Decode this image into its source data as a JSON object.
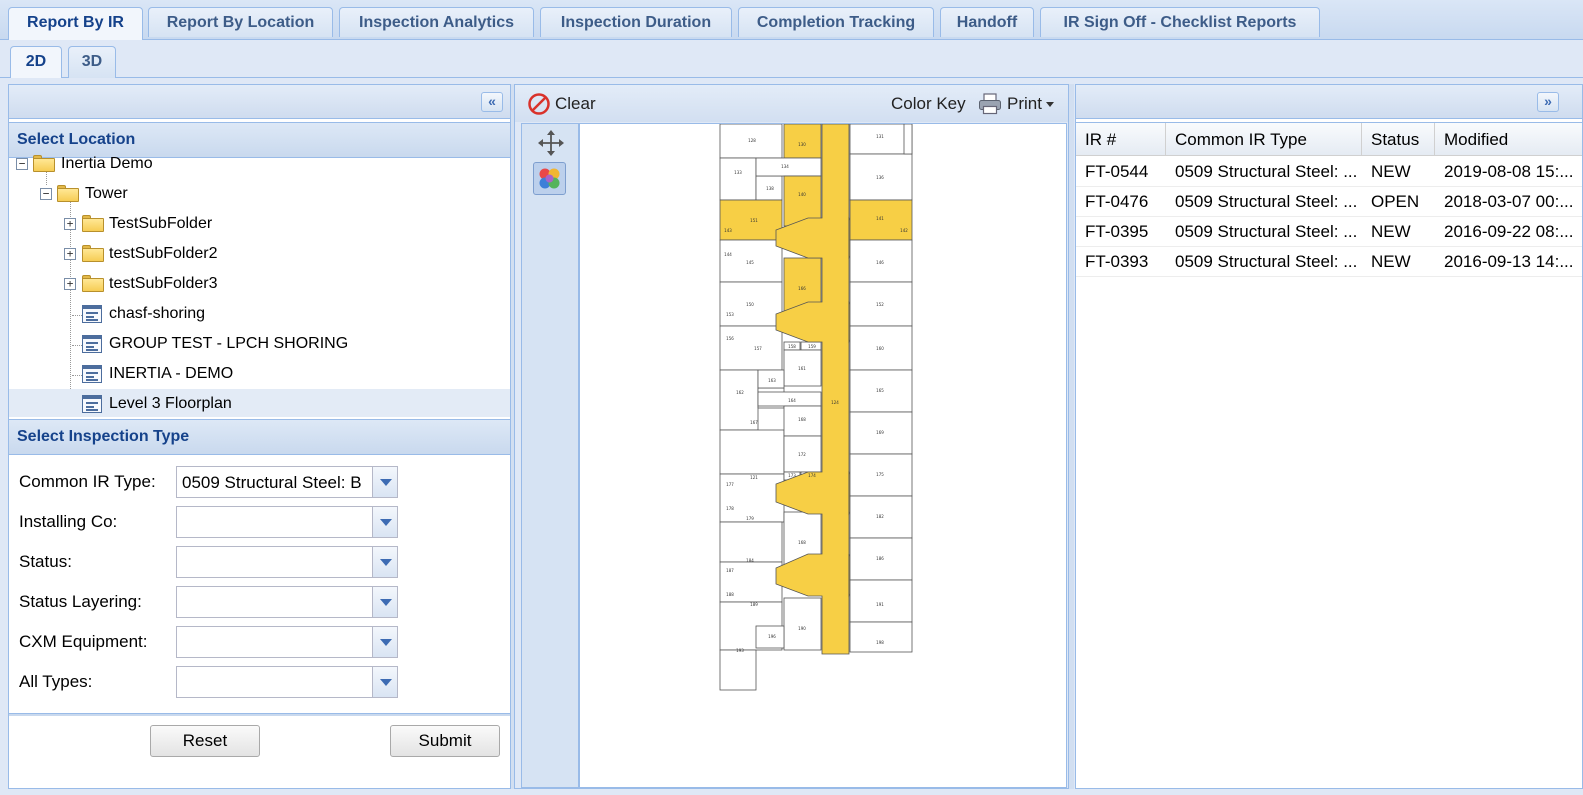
{
  "top_tabs": [
    "Report By IR",
    "Report By Location",
    "Inspection Analytics",
    "Inspection Duration",
    "Completion Tracking",
    "Handoff",
    "IR Sign Off - Checklist Reports"
  ],
  "view_tabs": [
    "2D",
    "3D"
  ],
  "left": {
    "location_title": "Select Location",
    "tree": {
      "root": "Inertia Demo",
      "tower": "Tower",
      "folders": [
        "TestSubFolder",
        "testSubFolder2",
        "testSubFolder3"
      ],
      "leaves": [
        "chasf-shoring",
        "GROUP TEST - LPCH SHORING",
        "INERTIA - DEMO",
        "Level 3 Floorplan"
      ]
    },
    "inspection_title": "Select Inspection Type",
    "fields": [
      {
        "label": "Common IR Type:",
        "value": "0509 Structural Steel: B"
      },
      {
        "label": "Installing Co:",
        "value": ""
      },
      {
        "label": "Status:",
        "value": ""
      },
      {
        "label": "Status Layering:",
        "value": ""
      },
      {
        "label": "CXM Equipment:",
        "value": ""
      },
      {
        "label": "All Types:",
        "value": ""
      }
    ],
    "reset_label": "Reset",
    "submit_label": "Submit"
  },
  "center": {
    "clear_label": "Clear",
    "color_key_label": "Color Key",
    "print_label": "Print",
    "highlight_color": "#f7cf45"
  },
  "grid": {
    "columns": [
      "IR #",
      "Common IR Type",
      "Status",
      "Modified"
    ],
    "rows": [
      [
        "FT-0544",
        "0509 Structural Steel: ...",
        "NEW",
        "2019-08-08 15:..."
      ],
      [
        "FT-0476",
        "0509 Structural Steel: ...",
        "OPEN",
        "2018-03-07 00:..."
      ],
      [
        "FT-0395",
        "0509 Structural Steel: ...",
        "NEW",
        "2016-09-22 08:..."
      ],
      [
        "FT-0393",
        "0509 Structural Steel: ...",
        "NEW",
        "2016-09-13 14:..."
      ]
    ]
  }
}
